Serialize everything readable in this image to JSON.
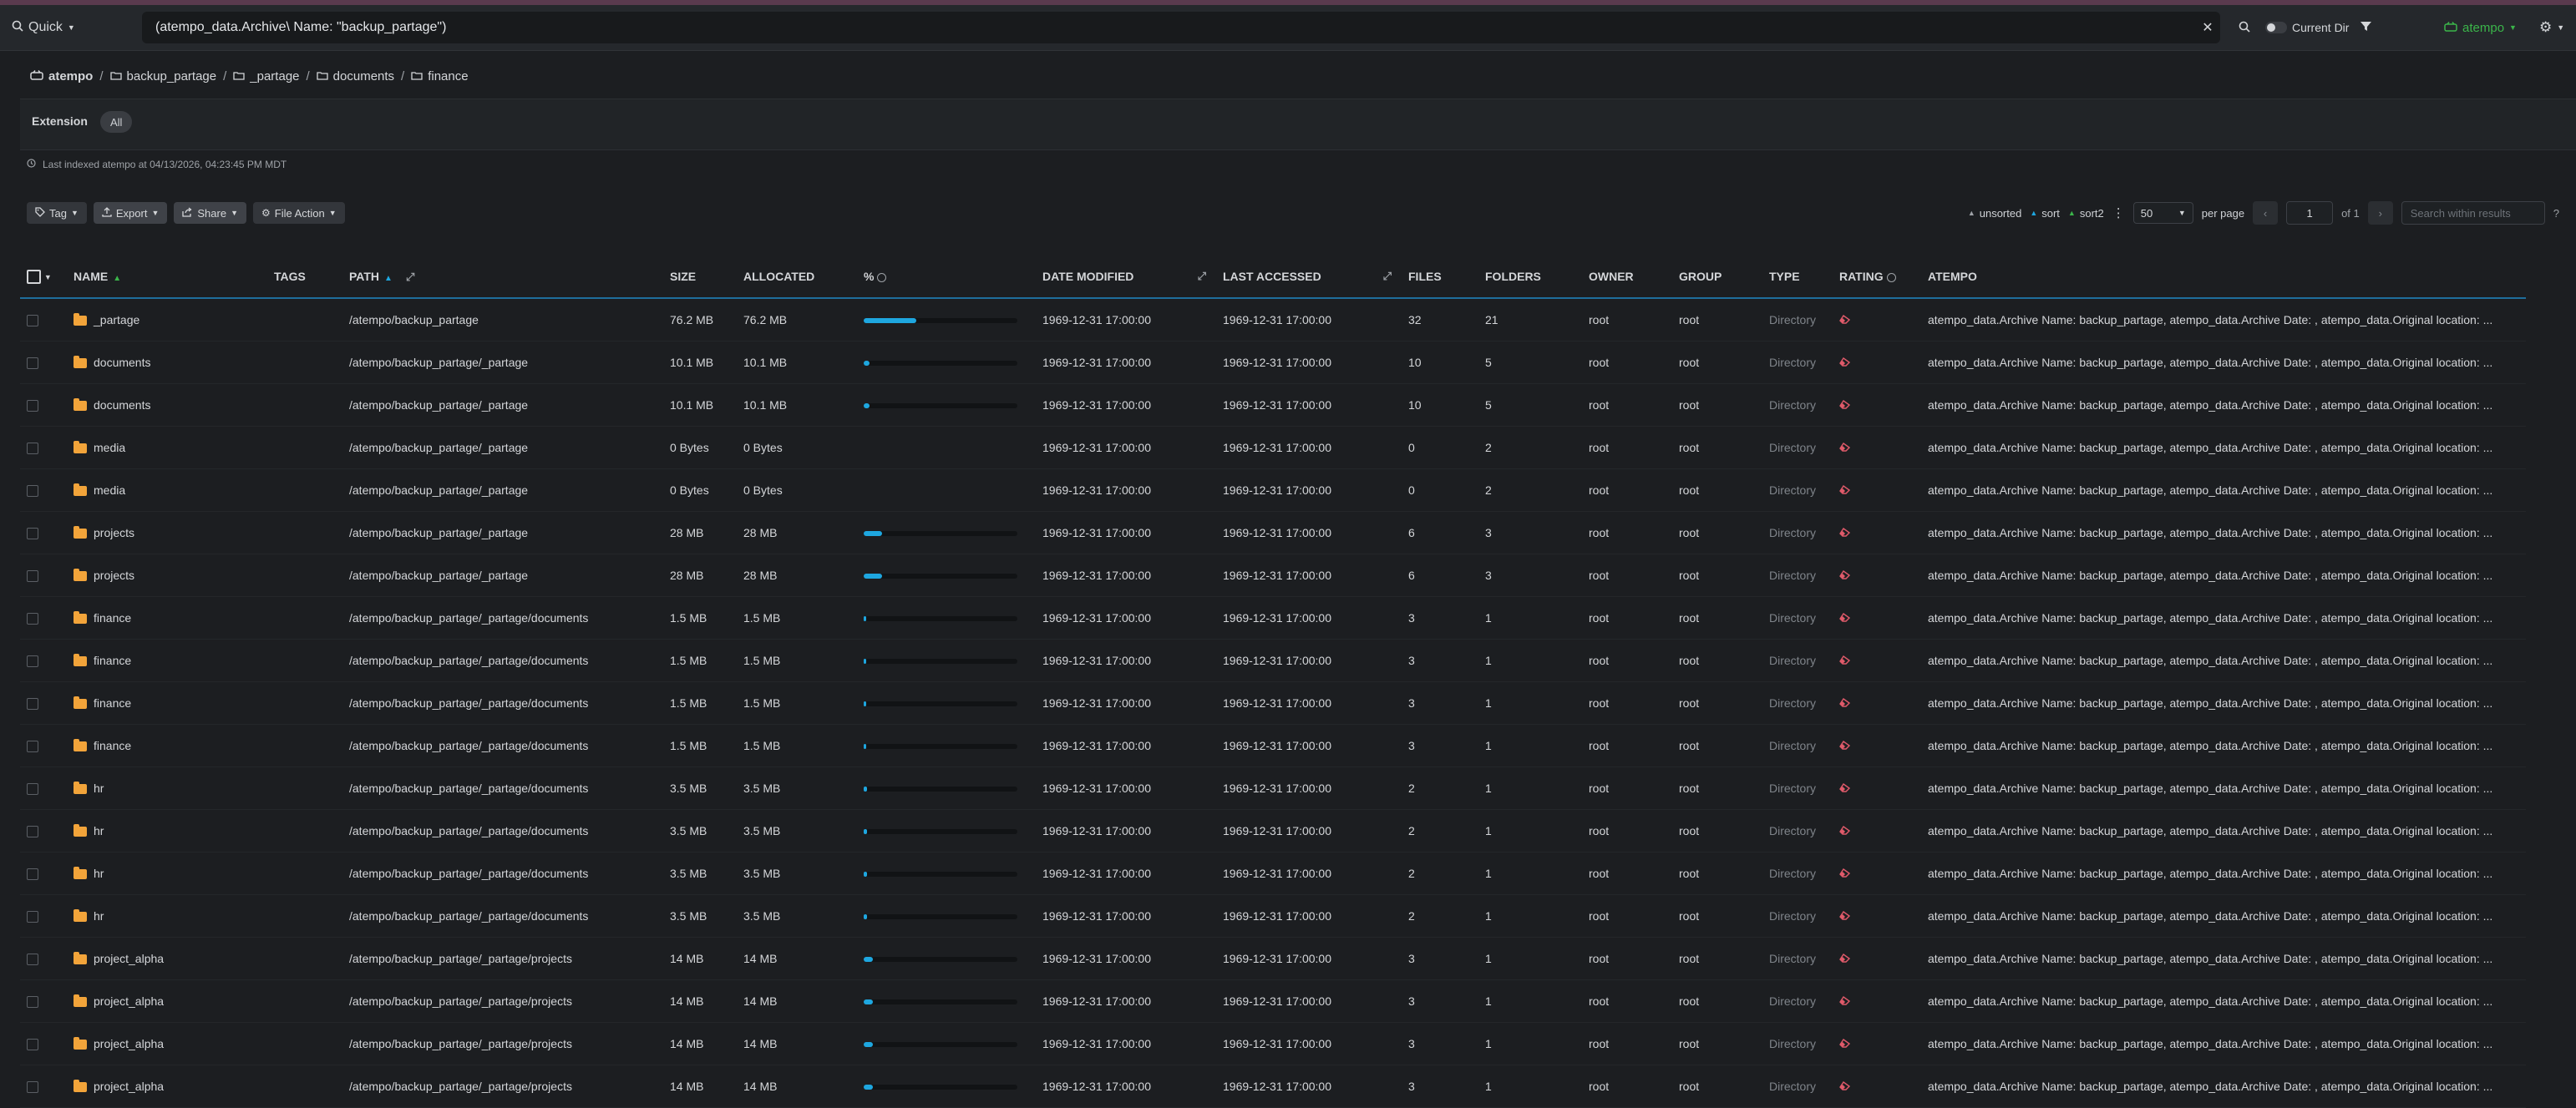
{
  "topbar": {
    "quick_label": "Quick",
    "search_value": "(atempo_data.Archive\\ Name: \"backup_partage\")",
    "current_dir_label": "Current Dir",
    "brand_label": "atempo"
  },
  "breadcrumb": {
    "root": "atempo",
    "items": [
      "backup_partage",
      "_partage",
      "documents",
      "finance"
    ]
  },
  "filters": {
    "extension_label": "Extension",
    "extension_value": "All"
  },
  "indexed_text": "Last indexed atempo at 04/13/2026, 04:23:45 PM MDT",
  "actions": {
    "tag": "Tag",
    "export": "Export",
    "share": "Share",
    "file_action": "File Action"
  },
  "controls": {
    "unsorted": "unsorted",
    "sort": "sort",
    "sort2": "sort2",
    "per_page_value": "50",
    "per_page_label": "per page",
    "page_value": "1",
    "page_of": "of 1",
    "search_placeholder": "Search within results"
  },
  "columns": {
    "name": "Name",
    "tags": "Tags",
    "path": "Path",
    "size": "Size",
    "allocated": "Allocated",
    "percent": "%",
    "date_modified": "Date Modified",
    "last_accessed": "Last Accessed",
    "files": "Files",
    "folders": "Folders",
    "owner": "Owner",
    "group": "Group",
    "type": "Type",
    "rating": "Rating",
    "atempo": "Atempo"
  },
  "rows": [
    {
      "name": "_partage",
      "path": "/atempo/backup_partage",
      "size": "76.2 MB",
      "allocated": "76.2 MB",
      "pct": 0.34,
      "modified": "1969-12-31 17:00:00",
      "accessed": "1969-12-31 17:00:00",
      "files": "32",
      "folders": "21",
      "owner": "root",
      "group": "root",
      "type": "Directory",
      "atempo": "atempo_data.Archive Name: backup_partage, atempo_data.Archive Date: , atempo_data.Original location: ..."
    },
    {
      "name": "documents",
      "path": "/atempo/backup_partage/_partage",
      "size": "10.1 MB",
      "allocated": "10.1 MB",
      "pct": 0.04,
      "modified": "1969-12-31 17:00:00",
      "accessed": "1969-12-31 17:00:00",
      "files": "10",
      "folders": "5",
      "owner": "root",
      "group": "root",
      "type": "Directory",
      "atempo": "atempo_data.Archive Name: backup_partage, atempo_data.Archive Date: , atempo_data.Original location: ..."
    },
    {
      "name": "documents",
      "path": "/atempo/backup_partage/_partage",
      "size": "10.1 MB",
      "allocated": "10.1 MB",
      "pct": 0.04,
      "modified": "1969-12-31 17:00:00",
      "accessed": "1969-12-31 17:00:00",
      "files": "10",
      "folders": "5",
      "owner": "root",
      "group": "root",
      "type": "Directory",
      "atempo": "atempo_data.Archive Name: backup_partage, atempo_data.Archive Date: , atempo_data.Original location: ..."
    },
    {
      "name": "media",
      "path": "/atempo/backup_partage/_partage",
      "size": "0 Bytes",
      "allocated": "0 Bytes",
      "pct": null,
      "modified": "1969-12-31 17:00:00",
      "accessed": "1969-12-31 17:00:00",
      "files": "0",
      "folders": "2",
      "owner": "root",
      "group": "root",
      "type": "Directory",
      "atempo": "atempo_data.Archive Name: backup_partage, atempo_data.Archive Date: , atempo_data.Original location: ..."
    },
    {
      "name": "media",
      "path": "/atempo/backup_partage/_partage",
      "size": "0 Bytes",
      "allocated": "0 Bytes",
      "pct": null,
      "modified": "1969-12-31 17:00:00",
      "accessed": "1969-12-31 17:00:00",
      "files": "0",
      "folders": "2",
      "owner": "root",
      "group": "root",
      "type": "Directory",
      "atempo": "atempo_data.Archive Name: backup_partage, atempo_data.Archive Date: , atempo_data.Original location: ..."
    },
    {
      "name": "projects",
      "path": "/atempo/backup_partage/_partage",
      "size": "28 MB",
      "allocated": "28 MB",
      "pct": 0.12,
      "modified": "1969-12-31 17:00:00",
      "accessed": "1969-12-31 17:00:00",
      "files": "6",
      "folders": "3",
      "owner": "root",
      "group": "root",
      "type": "Directory",
      "atempo": "atempo_data.Archive Name: backup_partage, atempo_data.Archive Date: , atempo_data.Original location: ..."
    },
    {
      "name": "projects",
      "path": "/atempo/backup_partage/_partage",
      "size": "28 MB",
      "allocated": "28 MB",
      "pct": 0.12,
      "modified": "1969-12-31 17:00:00",
      "accessed": "1969-12-31 17:00:00",
      "files": "6",
      "folders": "3",
      "owner": "root",
      "group": "root",
      "type": "Directory",
      "atempo": "atempo_data.Archive Name: backup_partage, atempo_data.Archive Date: , atempo_data.Original location: ..."
    },
    {
      "name": "finance",
      "path": "/atempo/backup_partage/_partage/documents",
      "size": "1.5 MB",
      "allocated": "1.5 MB",
      "pct": 0.01,
      "modified": "1969-12-31 17:00:00",
      "accessed": "1969-12-31 17:00:00",
      "files": "3",
      "folders": "1",
      "owner": "root",
      "group": "root",
      "type": "Directory",
      "atempo": "atempo_data.Archive Name: backup_partage, atempo_data.Archive Date: , atempo_data.Original location: ..."
    },
    {
      "name": "finance",
      "path": "/atempo/backup_partage/_partage/documents",
      "size": "1.5 MB",
      "allocated": "1.5 MB",
      "pct": 0.01,
      "modified": "1969-12-31 17:00:00",
      "accessed": "1969-12-31 17:00:00",
      "files": "3",
      "folders": "1",
      "owner": "root",
      "group": "root",
      "type": "Directory",
      "atempo": "atempo_data.Archive Name: backup_partage, atempo_data.Archive Date: , atempo_data.Original location: ..."
    },
    {
      "name": "finance",
      "path": "/atempo/backup_partage/_partage/documents",
      "size": "1.5 MB",
      "allocated": "1.5 MB",
      "pct": 0.01,
      "modified": "1969-12-31 17:00:00",
      "accessed": "1969-12-31 17:00:00",
      "files": "3",
      "folders": "1",
      "owner": "root",
      "group": "root",
      "type": "Directory",
      "atempo": "atempo_data.Archive Name: backup_partage, atempo_data.Archive Date: , atempo_data.Original location: ..."
    },
    {
      "name": "finance",
      "path": "/atempo/backup_partage/_partage/documents",
      "size": "1.5 MB",
      "allocated": "1.5 MB",
      "pct": 0.01,
      "modified": "1969-12-31 17:00:00",
      "accessed": "1969-12-31 17:00:00",
      "files": "3",
      "folders": "1",
      "owner": "root",
      "group": "root",
      "type": "Directory",
      "atempo": "atempo_data.Archive Name: backup_partage, atempo_data.Archive Date: , atempo_data.Original location: ..."
    },
    {
      "name": "hr",
      "path": "/atempo/backup_partage/_partage/documents",
      "size": "3.5 MB",
      "allocated": "3.5 MB",
      "pct": 0.02,
      "modified": "1969-12-31 17:00:00",
      "accessed": "1969-12-31 17:00:00",
      "files": "2",
      "folders": "1",
      "owner": "root",
      "group": "root",
      "type": "Directory",
      "atempo": "atempo_data.Archive Name: backup_partage, atempo_data.Archive Date: , atempo_data.Original location: ..."
    },
    {
      "name": "hr",
      "path": "/atempo/backup_partage/_partage/documents",
      "size": "3.5 MB",
      "allocated": "3.5 MB",
      "pct": 0.02,
      "modified": "1969-12-31 17:00:00",
      "accessed": "1969-12-31 17:00:00",
      "files": "2",
      "folders": "1",
      "owner": "root",
      "group": "root",
      "type": "Directory",
      "atempo": "atempo_data.Archive Name: backup_partage, atempo_data.Archive Date: , atempo_data.Original location: ..."
    },
    {
      "name": "hr",
      "path": "/atempo/backup_partage/_partage/documents",
      "size": "3.5 MB",
      "allocated": "3.5 MB",
      "pct": 0.02,
      "modified": "1969-12-31 17:00:00",
      "accessed": "1969-12-31 17:00:00",
      "files": "2",
      "folders": "1",
      "owner": "root",
      "group": "root",
      "type": "Directory",
      "atempo": "atempo_data.Archive Name: backup_partage, atempo_data.Archive Date: , atempo_data.Original location: ..."
    },
    {
      "name": "hr",
      "path": "/atempo/backup_partage/_partage/documents",
      "size": "3.5 MB",
      "allocated": "3.5 MB",
      "pct": 0.02,
      "modified": "1969-12-31 17:00:00",
      "accessed": "1969-12-31 17:00:00",
      "files": "2",
      "folders": "1",
      "owner": "root",
      "group": "root",
      "type": "Directory",
      "atempo": "atempo_data.Archive Name: backup_partage, atempo_data.Archive Date: , atempo_data.Original location: ..."
    },
    {
      "name": "project_alpha",
      "path": "/atempo/backup_partage/_partage/projects",
      "size": "14 MB",
      "allocated": "14 MB",
      "pct": 0.06,
      "modified": "1969-12-31 17:00:00",
      "accessed": "1969-12-31 17:00:00",
      "files": "3",
      "folders": "1",
      "owner": "root",
      "group": "root",
      "type": "Directory",
      "atempo": "atempo_data.Archive Name: backup_partage, atempo_data.Archive Date: , atempo_data.Original location: ..."
    },
    {
      "name": "project_alpha",
      "path": "/atempo/backup_partage/_partage/projects",
      "size": "14 MB",
      "allocated": "14 MB",
      "pct": 0.06,
      "modified": "1969-12-31 17:00:00",
      "accessed": "1969-12-31 17:00:00",
      "files": "3",
      "folders": "1",
      "owner": "root",
      "group": "root",
      "type": "Directory",
      "atempo": "atempo_data.Archive Name: backup_partage, atempo_data.Archive Date: , atempo_data.Original location: ..."
    },
    {
      "name": "project_alpha",
      "path": "/atempo/backup_partage/_partage/projects",
      "size": "14 MB",
      "allocated": "14 MB",
      "pct": 0.06,
      "modified": "1969-12-31 17:00:00",
      "accessed": "1969-12-31 17:00:00",
      "files": "3",
      "folders": "1",
      "owner": "root",
      "group": "root",
      "type": "Directory",
      "atempo": "atempo_data.Archive Name: backup_partage, atempo_data.Archive Date: , atempo_data.Original location: ..."
    },
    {
      "name": "project_alpha",
      "path": "/atempo/backup_partage/_partage/projects",
      "size": "14 MB",
      "allocated": "14 MB",
      "pct": 0.06,
      "modified": "1969-12-31 17:00:00",
      "accessed": "1969-12-31 17:00:00",
      "files": "3",
      "folders": "1",
      "owner": "root",
      "group": "root",
      "type": "Directory",
      "atempo": "atempo_data.Archive Name: backup_partage, atempo_data.Archive Date: , atempo_data.Original location: ..."
    }
  ]
}
